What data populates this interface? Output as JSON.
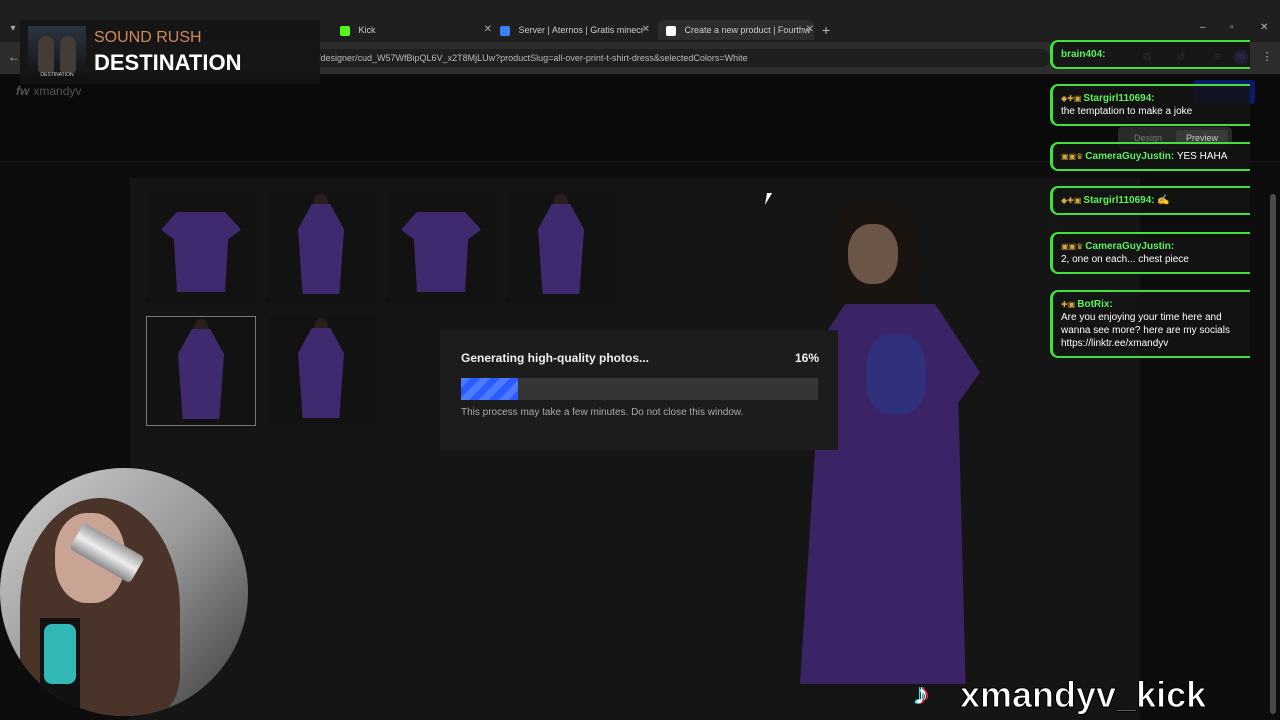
{
  "browser": {
    "tabs": [
      {
        "label": "",
        "color": "#444"
      },
      {
        "label": "Kick",
        "color": "#53fc18"
      },
      {
        "label": "Server | Aternos | Gratis minecr",
        "color": "#3b82f6"
      },
      {
        "label": "Create a new product | Fourthw",
        "color": "#ffffff"
      }
    ],
    "url": "/designer/cud_W57WfBipQL6V_x2T8MjLUw?productSlug=all-over-print-t-shirt-dress&selectedColors=White",
    "profile_initial": "m"
  },
  "page": {
    "logo_mark": "fw",
    "logo_user": "xmandyv",
    "mode_design": "Design",
    "mode_preview": "Preview"
  },
  "dialog": {
    "title": "Generating high-quality photos...",
    "percent_label": "16%",
    "progress": 0.16,
    "note": "This process may take a few minutes. Do not close this window."
  },
  "overlay": {
    "now_playing_artist": "SOUND RUSH",
    "now_playing_title": "DESTINATION",
    "album_caption": "DESTINATION",
    "handle": "xmandyv_kick"
  },
  "chat": [
    {
      "user": "brain404:",
      "text": ""
    },
    {
      "user": "Stargirl110694:",
      "text": "the temptation to make a joke"
    },
    {
      "user": "CameraGuyJustin:",
      "text": "YES HAHA"
    },
    {
      "user": "Stargirl110694:",
      "text": "✍"
    },
    {
      "user": "CameraGuyJustin:",
      "text": "2, one on each... chest piece"
    },
    {
      "user": "BotRix:",
      "text": "Are you enjoying your time here and wanna see more? here are my socials https://linktr.ee/xmandyv"
    }
  ],
  "colors": {
    "accent_blue": "#2b5cff",
    "chat_green": "#3fe03f"
  }
}
